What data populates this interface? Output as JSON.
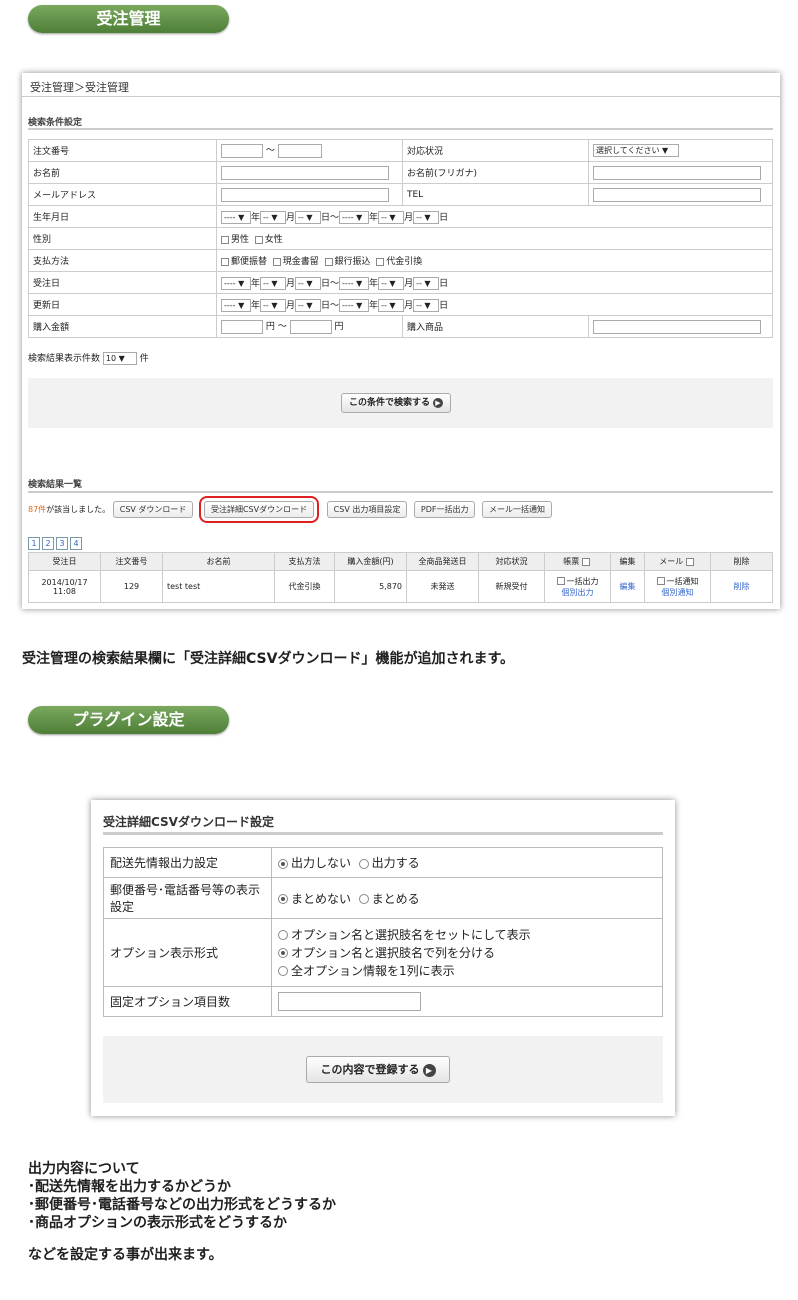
{
  "section1": {
    "pill": "受注管理"
  },
  "order_panel": {
    "breadcrumb": "受注管理＞受注管理",
    "search_heading": "検索条件設定",
    "rows": {
      "order_no": "注文番号",
      "tilde": "〜",
      "status": "対応状況",
      "status_select": "選択してください ▼",
      "name": "お名前",
      "name_kana": "お名前(フリガナ)",
      "email": "メールアドレス",
      "tel": "TEL",
      "birthday": "生年月日",
      "gender": "性別",
      "male": "男性",
      "female": "女性",
      "payment": "支払方法",
      "pay_options": [
        "郵便振替",
        "現金書留",
        "銀行振込",
        "代金引換"
      ],
      "order_date": "受注日",
      "update_date": "更新日",
      "amount": "購入金額",
      "yen_tilde": "円 〜",
      "yen": "円",
      "product": "購入商品"
    },
    "date_selects": {
      "year": "---- ▼",
      "month": "-- ▼",
      "day": "-- ▼"
    },
    "date_units": {
      "year": "年",
      "month": "月",
      "day": "日",
      "day_tilde": "日〜"
    },
    "count_label": "検索結果表示件数",
    "count_value": "10 ▼",
    "count_unit": "件",
    "search_button": "この条件で検索する",
    "results_heading": "検索結果一覧",
    "hits_count": "87件",
    "hits_text": "が該当しました。",
    "action_buttons": [
      "CSV ダウンロード",
      "受注詳細CSVダウンロード",
      "CSV 出力項目設定",
      "PDF一括出力",
      "メール一括通知"
    ],
    "pages": [
      "1",
      "2",
      "3",
      "4"
    ],
    "columns": [
      "受注日",
      "注文番号",
      "お名前",
      "支払方法",
      "購入金額(円)",
      "全商品発送日",
      "対応状況",
      "帳票",
      "編集",
      "メール",
      "削除"
    ],
    "row": {
      "date": "2014/10/17",
      "time": "11:08",
      "order_no": "129",
      "name": "test test",
      "payment": "代金引換",
      "amount": "5,870",
      "shipped": "未発送",
      "status": "新規受付",
      "bulk_output": "一括出力",
      "individual_output": "個別出力",
      "edit": "編集",
      "bulk_notify": "一括通知",
      "individual_notify": "個別通知",
      "delete": "削除"
    }
  },
  "caption1": "受注管理の検索結果欄に「受注詳細CSVダウンロード」機能が追加されます。",
  "section2": {
    "pill": "プラグイン設定"
  },
  "plugin_panel": {
    "title": "受注詳細CSVダウンロード設定",
    "rows": [
      {
        "label": "配送先情報出力設定",
        "options": [
          "出力しない",
          "出力する"
        ],
        "selected": 0
      },
      {
        "label": "郵便番号･電話番号等の表示設定",
        "options": [
          "まとめない",
          "まとめる"
        ],
        "selected": 0
      },
      {
        "label": "オプション表示形式",
        "options": [
          "オプション名と選択肢名をセットにして表示",
          "オプション名と選択肢名で列を分ける",
          "全オプション情報を1列に表示"
        ],
        "selected": 1
      },
      {
        "label": "固定オプション項目数"
      }
    ],
    "submit_button": "この内容で登録する"
  },
  "bottom_text": {
    "line1": "出力内容について",
    "line2": "･配送先情報を出力するかどうか",
    "line3": "･郵便番号･電話番号などの出力形式をどうするか",
    "line4": "･商品オプションの表示形式をどうするか",
    "line5": "などを設定する事が出来ます。"
  },
  "colors": {
    "pill_green": "#5a8c40",
    "highlight_red": "#e02020",
    "hits_orange": "#e06a10",
    "link_blue": "#3366cc"
  }
}
